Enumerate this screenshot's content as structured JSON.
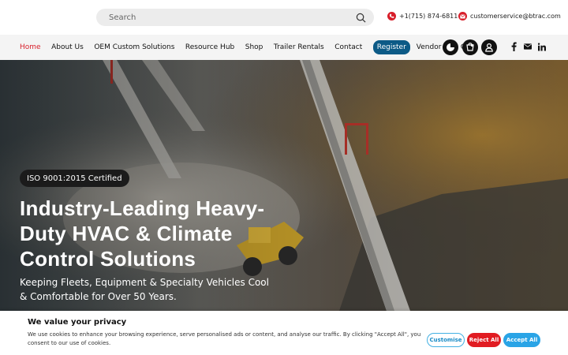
{
  "search": {
    "placeholder": "Search"
  },
  "contact": {
    "phone": "+1(715) 874-6811",
    "email": "customerservice@btrac.com"
  },
  "nav": {
    "items": [
      "Home",
      "About Us",
      "OEM Custom Solutions",
      "Resource Hub",
      "Shop",
      "Trailer Rentals",
      "Contact"
    ],
    "register": "Register",
    "vendor": "Vendor Line Card"
  },
  "hero": {
    "badge": "ISO 9001:2015 Certified",
    "headline": "Industry-Leading Heavy-Duty HVAC & Climate Control Solutions",
    "subline": "Keeping Fleets, Equipment & Specialty Vehicles Cool & Comfortable for Over 50 Years."
  },
  "cookie": {
    "title": "We value your privacy",
    "text": "We use cookies to enhance your browsing experience, serve personalised ads or content, and analyse our traffic. By clicking \"Accept All\", you consent to our use of cookies.",
    "customise": "Customise",
    "reject": "Reject All",
    "accept": "Accept All"
  },
  "colors": {
    "accent": "#d81e2a",
    "register": "#0c5a86",
    "accept": "#2aa4e6"
  }
}
